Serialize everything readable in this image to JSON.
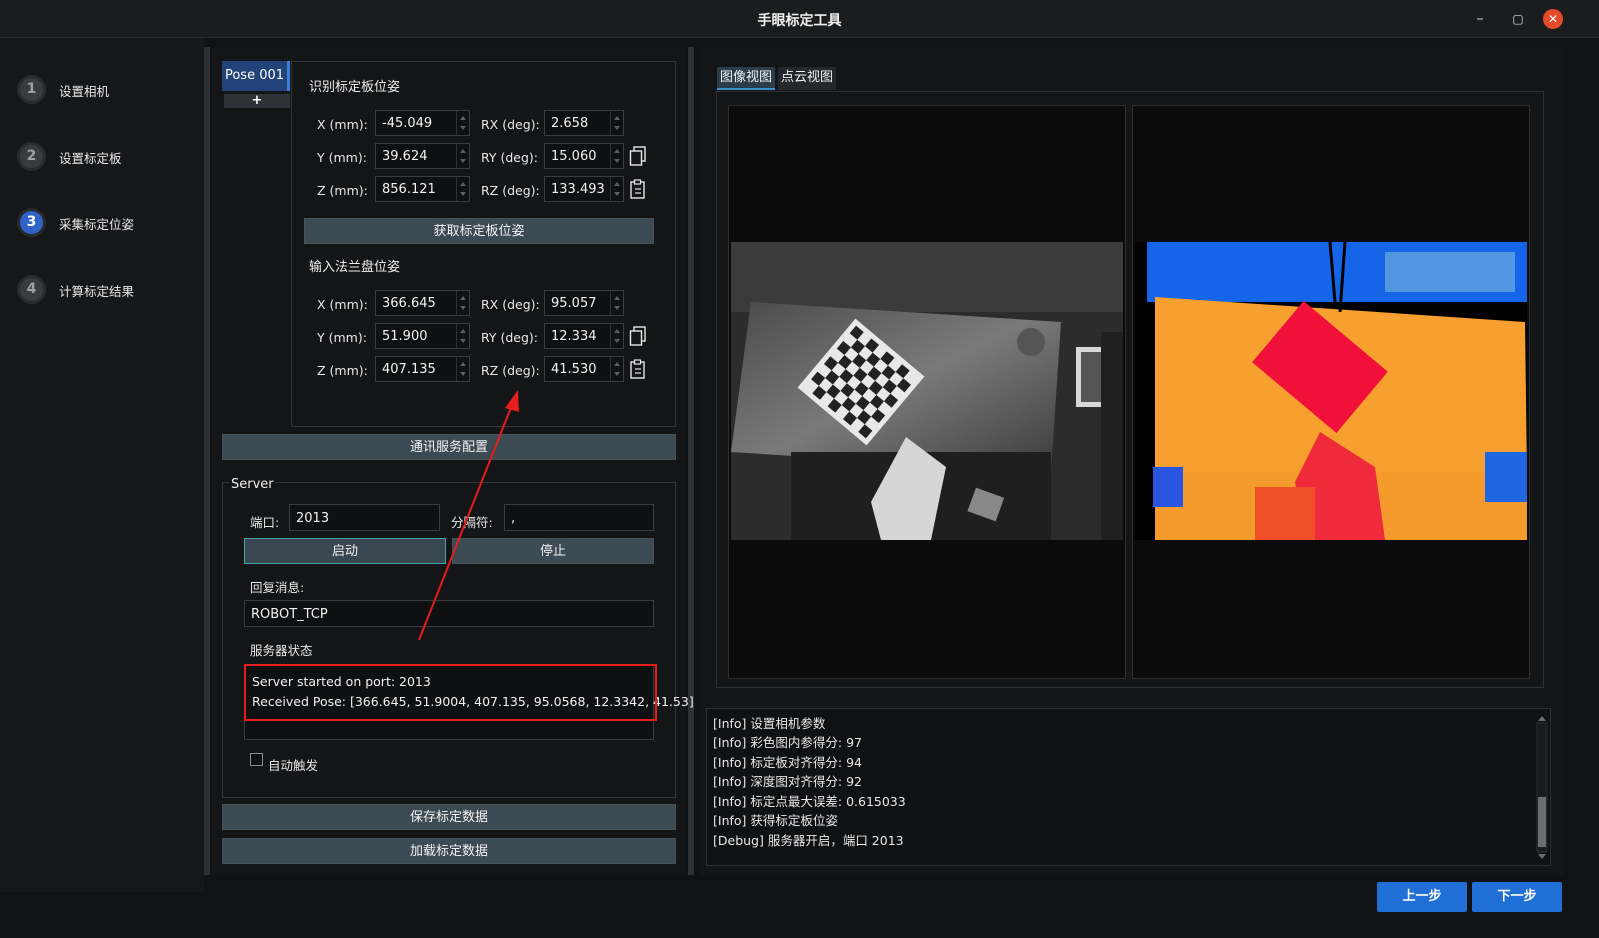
{
  "window": {
    "title": "手眼标定工具"
  },
  "window_controls": {
    "minimize": "–",
    "maximize": "▢",
    "close": "✕"
  },
  "steps": [
    {
      "num": "1",
      "label": "设置相机"
    },
    {
      "num": "2",
      "label": "设置标定板"
    },
    {
      "num": "3",
      "label": "采集标定位姿"
    },
    {
      "num": "4",
      "label": "计算标定结果"
    }
  ],
  "active_step": 3,
  "pose_tabs": {
    "current": "Pose 001",
    "add": "+"
  },
  "board_pose": {
    "title": "识别标定板位姿",
    "fields": {
      "x": {
        "label": "X (mm):",
        "value": "-45.049"
      },
      "y": {
        "label": "Y (mm):",
        "value": "39.624"
      },
      "z": {
        "label": "Z (mm):",
        "value": "856.121"
      },
      "rx": {
        "label": "RX (deg):",
        "value": "2.658"
      },
      "ry": {
        "label": "RY (deg):",
        "value": "15.060"
      },
      "rz": {
        "label": "RZ (deg):",
        "value": "133.493"
      }
    },
    "get_button": "获取标定板位姿"
  },
  "flange_pose": {
    "title": "输入法兰盘位姿",
    "fields": {
      "x": {
        "label": "X (mm):",
        "value": "366.645"
      },
      "y": {
        "label": "Y (mm):",
        "value": "51.900"
      },
      "z": {
        "label": "Z (mm):",
        "value": "407.135"
      },
      "rx": {
        "label": "RX (deg):",
        "value": "95.057"
      },
      "ry": {
        "label": "RY (deg):",
        "value": "12.334"
      },
      "rz": {
        "label": "RZ (deg):",
        "value": "41.530"
      }
    }
  },
  "comm_button": "通讯服务配置",
  "server": {
    "group_title": "Server",
    "port_label": "端口:",
    "port_value": "2013",
    "sep_label": "分隔符:",
    "sep_value": ",",
    "start_button": "启动",
    "stop_button": "停止",
    "reply_label": "回复消息:",
    "reply_value": "ROBOT_TCP",
    "status_label": "服务器状态",
    "status_lines": [
      "Server started on port: 2013",
      "Received Pose: [366.645, 51.9004, 407.135, 95.0568, 12.3342, 41.53]"
    ],
    "auto_trigger_label": "自动触发",
    "auto_trigger_checked": false
  },
  "save_button": "保存标定数据",
  "load_button": "加载标定数据",
  "view_tabs": [
    "图像视图",
    "点云视图"
  ],
  "active_view": "图像视图",
  "log_lines": [
    "[Info] 设置相机参数",
    "[Info] 彩色图内参得分:  97",
    "[Info] 标定板对齐得分:  94",
    "[Info] 深度图对齐得分:  92",
    "[Info] 标定点最大误差:  0.615033",
    "[Info] 获得标定板位姿",
    "[Debug] 服务器开启，端口 2013"
  ],
  "nav": {
    "prev": "上一步",
    "next": "下一步"
  },
  "colors": {
    "accent": "#1f6fd6",
    "highlight": "#e51d1d",
    "button": "#3c4a54"
  }
}
